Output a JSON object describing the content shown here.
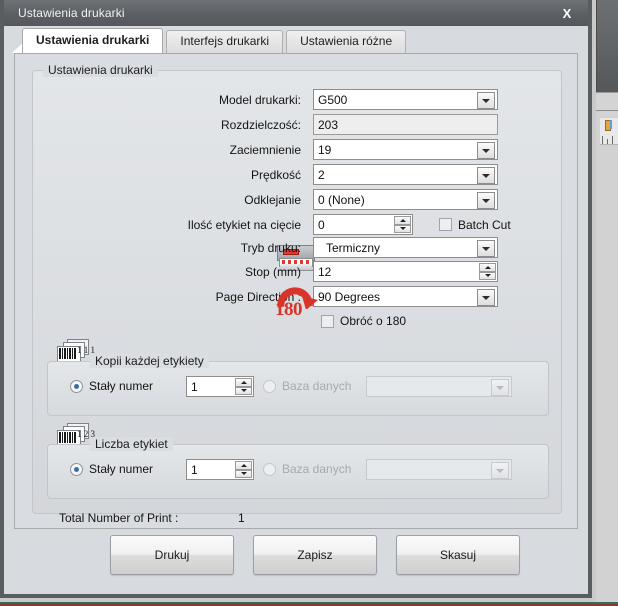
{
  "window": {
    "title": "Ustawienia drukarki",
    "close_label": "X"
  },
  "tabs": [
    {
      "label": "Ustawienia drukarki",
      "active": true
    },
    {
      "label": "Interfejs drukarki",
      "active": false
    },
    {
      "label": "Ustawienia różne",
      "active": false
    }
  ],
  "printer_settings": {
    "group_title": "Ustawienia drukarki",
    "fields": [
      {
        "label": "Model drukarki:",
        "value": "G500",
        "type": "combo"
      },
      {
        "label": "Rozdzielczość:",
        "value": "203",
        "type": "readonly"
      },
      {
        "label": "Zaciemnienie",
        "value": "19",
        "type": "combo"
      },
      {
        "label": "Prędkość",
        "value": "2",
        "type": "combo"
      },
      {
        "label": "Odklejanie",
        "value": "0 (None)",
        "type": "combo"
      },
      {
        "label": "Ilość etykiet na cięcie",
        "value": "0",
        "type": "spinner"
      },
      {
        "label": "Tryb druku:",
        "value": "Termiczny",
        "type": "combo"
      },
      {
        "label": "Stop (mm)",
        "value": "12",
        "type": "spinner"
      },
      {
        "label": "Page Direction :",
        "value": "90 Degrees",
        "type": "combo"
      }
    ],
    "batch_cut": {
      "label": "Batch Cut",
      "checked": false
    },
    "rotate180": {
      "label": "Obróć o 180",
      "checked": false
    },
    "rotate_icon_number": "180",
    "rotate_icon_degree": "°"
  },
  "copies_group": {
    "title": "Kopii każdej etykiety",
    "icon_numbers": "1 1 1",
    "fixed_radio": {
      "label": "Stały numer",
      "checked": true
    },
    "fixed_value": "1",
    "database_radio": {
      "label": "Baza danych",
      "checked": false,
      "disabled": true
    },
    "database_value": ""
  },
  "count_group": {
    "title": "Liczba etykiet",
    "icon_numbers": "1 2 3",
    "fixed_radio": {
      "label": "Stały numer",
      "checked": true
    },
    "fixed_value": "1",
    "database_radio": {
      "label": "Baza danych",
      "checked": false,
      "disabled": true
    },
    "database_value": ""
  },
  "total": {
    "label": "Total Number of Print :",
    "value": "1"
  },
  "buttons": [
    {
      "label": "Drukuj"
    },
    {
      "label": "Zapisz"
    },
    {
      "label": "Skasuj"
    }
  ],
  "colors": {
    "titlebar": "#5d6165",
    "accent_red": "#d8342a",
    "radio_dot": "#3a6ea5",
    "page_bg": "#d9dce0"
  }
}
